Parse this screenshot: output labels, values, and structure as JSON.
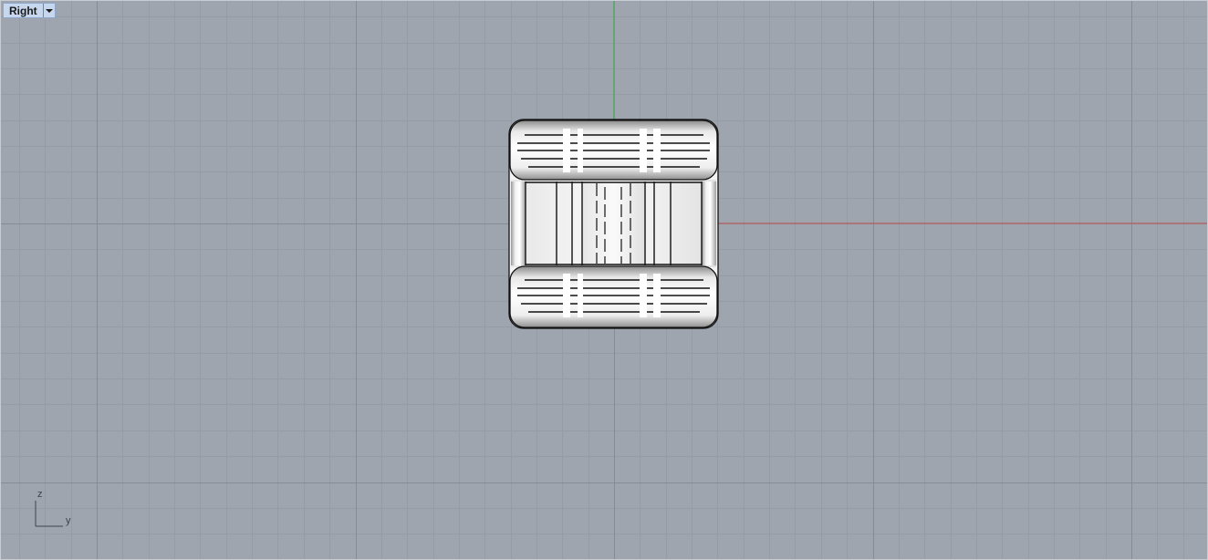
{
  "viewport": {
    "title": "Right",
    "colors": {
      "background": "#9ea5ae",
      "grid_minor": "#959ca5",
      "grid_major": "#858c96",
      "x_axis": "#b35a5a",
      "z_axis": "#3fa64a",
      "object_outline": "#111111"
    },
    "axis_widget": {
      "vertical_label": "z",
      "horizontal_label": "y"
    },
    "menu_icon": "triangle-down-icon"
  }
}
